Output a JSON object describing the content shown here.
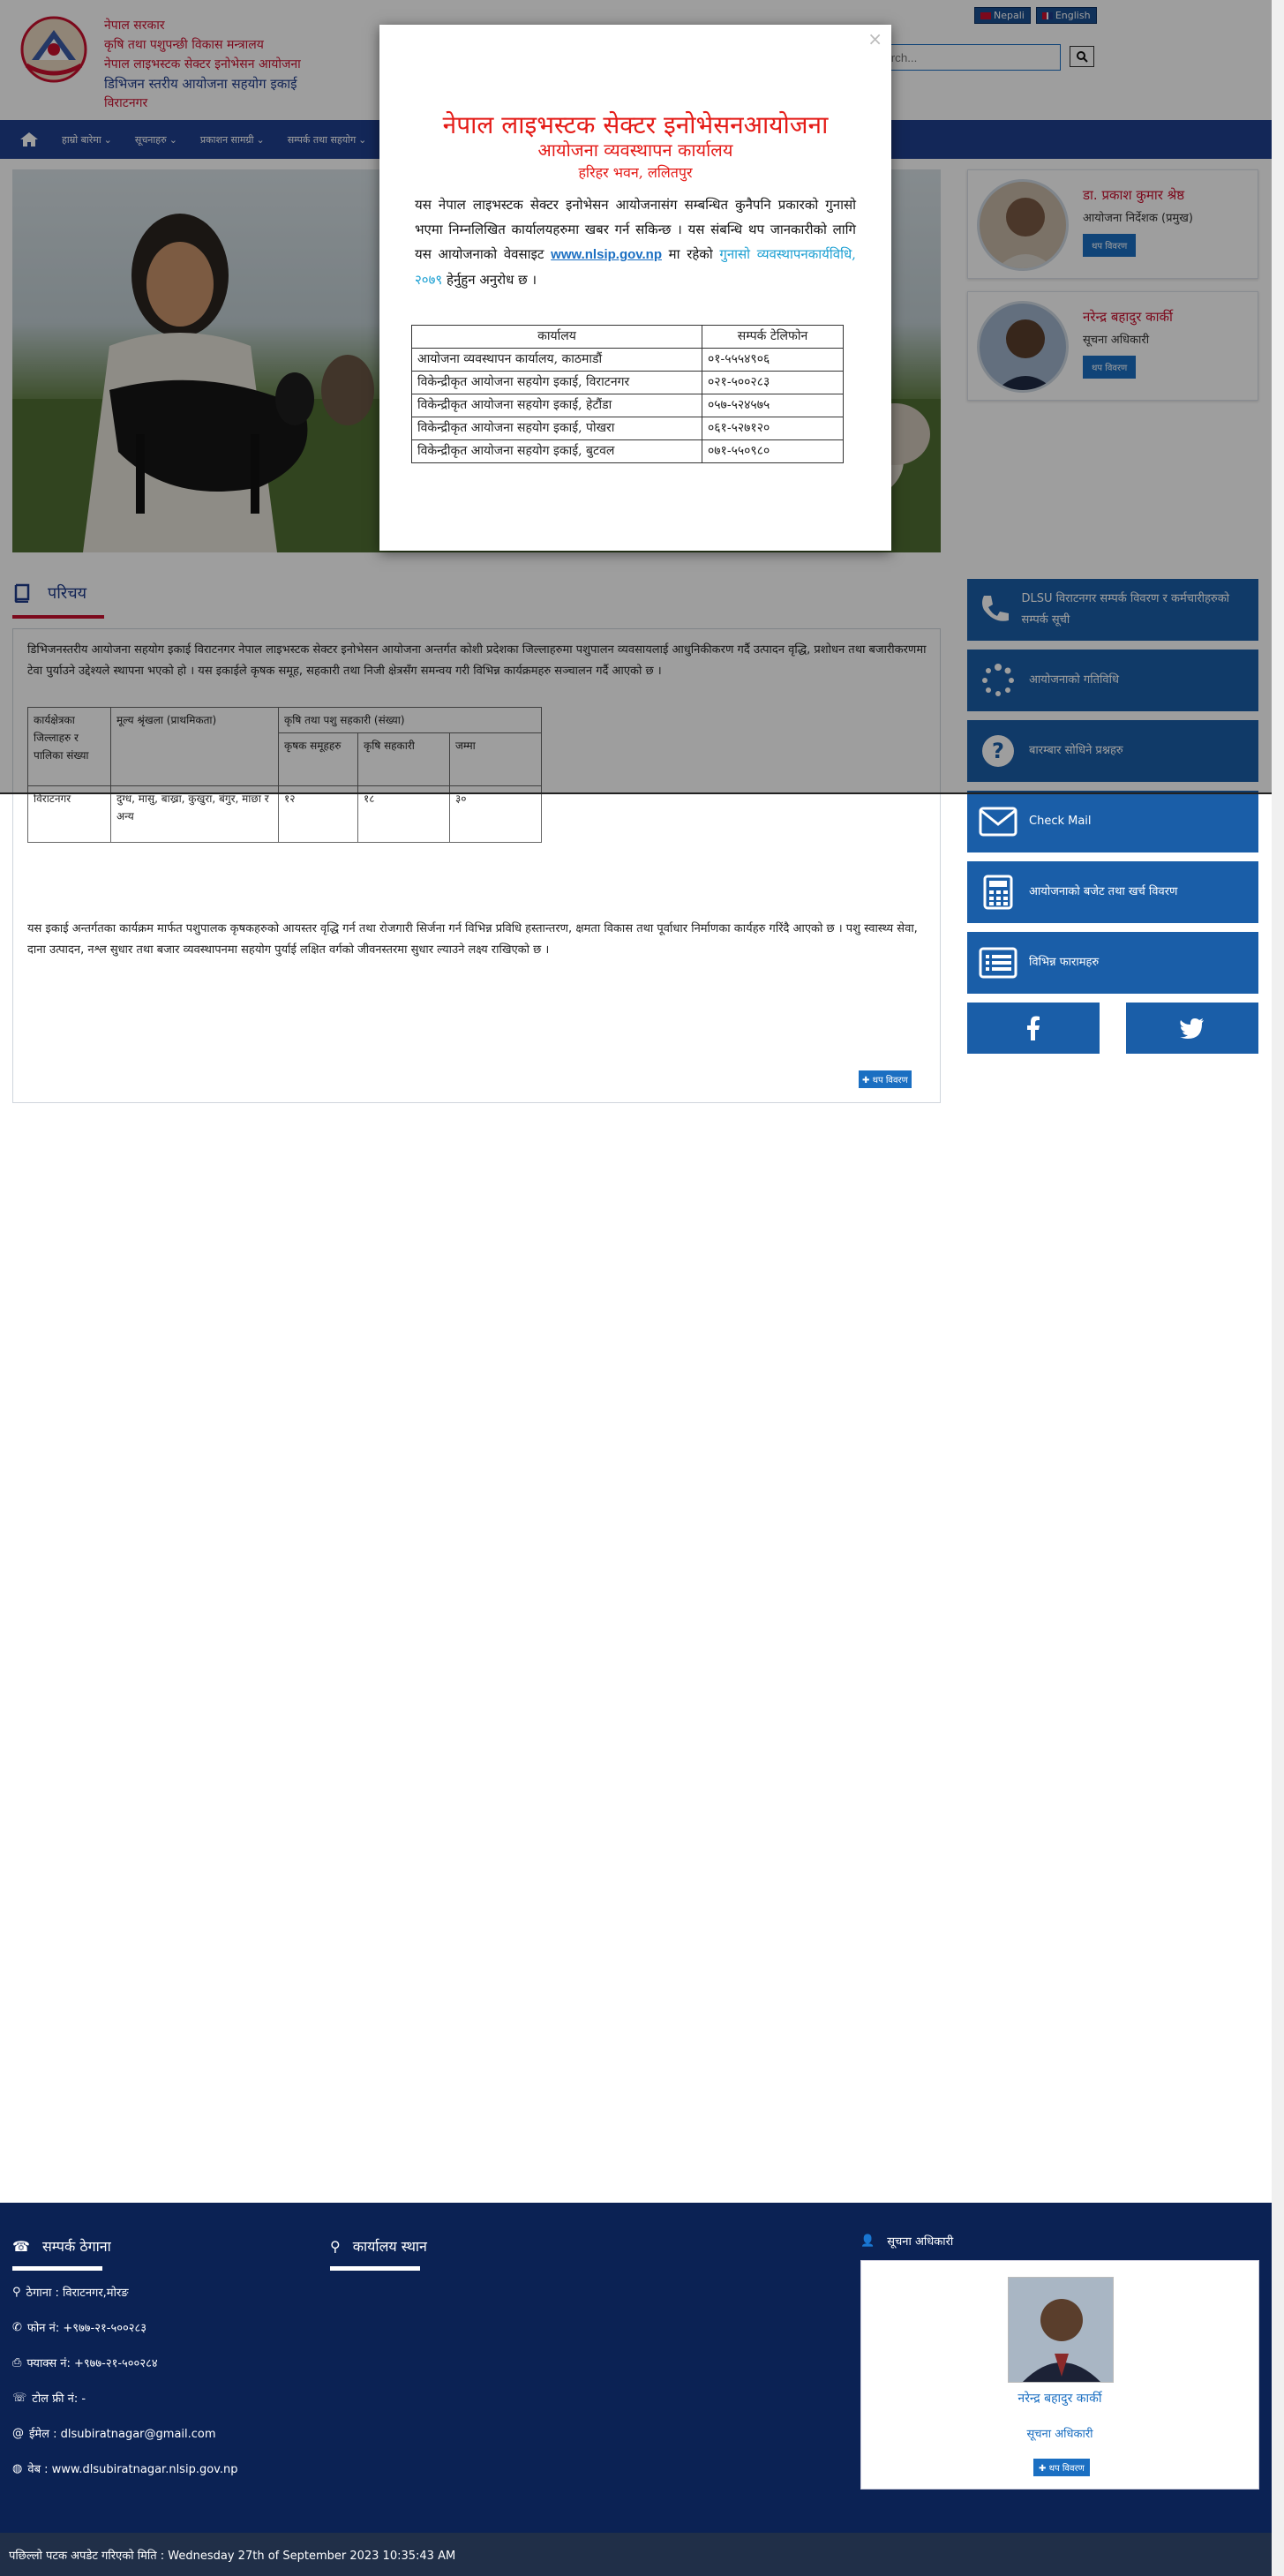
{
  "header": {
    "gov_line1": "नेपाल सरकार",
    "gov_line2": "कृषि तथा पशुपन्छी विकास मन्त्रालय",
    "gov_line3": "नेपाल लाइभस्टक सेक्टर इनोभेसन आयोजना",
    "gov_line4": "डिभिजन स्तरीय आयोजना सहयोग इकाई",
    "gov_line5": "विराटनगर",
    "lang_nepali": "Nepali",
    "lang_english": "English",
    "search_placeholder": "Search..."
  },
  "nav": {
    "items": [
      "हाम्रो बारेमा",
      "सूचनाहरु",
      "प्रकाशन सामग्री",
      "सम्पर्क तथा सहयोग"
    ]
  },
  "officials": [
    {
      "name": "डा. प्रकाश कुमार श्रेष्ठ",
      "role": "आयोजना निर्देशक (प्रमुख)",
      "more": "थप विवरण"
    },
    {
      "name": "नरेन्द्र बहादुर कार्की",
      "role": "सूचना अधिकारी",
      "more": "थप विवरण"
    }
  ],
  "side_buttons": [
    {
      "icon": "phone-icon",
      "label": "DLSU विराटनगर सम्पर्क विवरण र कर्मचारीहरुको सम्पर्क सूची"
    },
    {
      "icon": "spinner-icon",
      "label": "आयोजनाको गतिविधि"
    },
    {
      "icon": "question-icon",
      "label": "बारम्बार सोधिने प्रश्नहरु"
    },
    {
      "icon": "mail-icon",
      "label": "Check Mail"
    },
    {
      "icon": "calculator-icon",
      "label": "आयोजनाको बजेट तथा खर्च विवरण"
    },
    {
      "icon": "list-icon",
      "label": "विभिन्न फारामहरु"
    }
  ],
  "intro": {
    "title": "परिचय",
    "para1": "डिभिजनस्तरीय आयोजना सहयोग इकाई विराटनगर नेपाल लाइभस्टक सेक्टर इनोभेसन आयोजना अन्तर्गत कोशी प्रदेशका जिल्लाहरुमा पशुपालन व्यवसायलाई आधुनिकीकरण गर्दै उत्पादन वृद्धि, प्रशोधन तथा बजारीकरणमा टेवा पुर्याउने उद्देश्यले स्थापना भएको हो । यस इकाईले कृषक समूह, सहकारी तथा निजी क्षेत्रसँग समन्वय गरी विभिन्न कार्यक्रमहरु सञ्चालन गर्दै आएको छ ।",
    "table": {
      "h_district": "कार्यक्षेत्रका जिल्लाहरु र पालिका संख्या",
      "h_sector": "मूल्य श्रृंखला (प्राथमिकता)",
      "h_group": "कृषि तथा पशु सहकारी (संख्या)",
      "h_col1": "कृषक समूहहरु",
      "h_col2": "कृषि सहकारी",
      "h_col3": "जम्मा",
      "row_district": "विराटनगर",
      "row_sector": "दुग्ध, मासु, बाख्रा, कुखुरा, बंगुर, माछा र अन्य",
      "row_v1": "१२",
      "row_v2": "१८",
      "row_v3": "३०"
    },
    "para2": "यस इकाई अन्तर्गतका कार्यक्रम मार्फत पशुपालक कृषकहरुको आयस्तर वृद्धि गर्न तथा रोजगारी सिर्जना गर्न विभिन्न प्रविधि हस्तान्तरण, क्षमता विकास तथा पूर्वाधार निर्माणका कार्यहरु गरिंदै आएको छ । पशु स्वास्थ्य सेवा, दाना उत्पादन, नश्ल सुधार तथा बजार व्यवस्थापनमा सहयोग पुर्याई लक्षित वर्गको जीवनस्तरमा सुधार ल्याउने लक्ष्य राखिएको छ ।",
    "read_more": "थप विवरण"
  },
  "modal": {
    "title": "नेपाल लाइभस्टक सेक्टर इनोभेसनआयोजना",
    "subtitle": "आयोजना व्यवस्थापन कार्यालय",
    "address": "हरिहर भवन, ललितपुर",
    "body_pre": "यस नेपाल लाइभस्टक सेक्टर इनोभेसन आयोजनासंग सम्बन्धित कुनैपनि प्रकारको गुनासो भएमा निम्नलिखित कार्यालयहरुमा खबर गर्न सकिन्छ । यस संबन्धि थप जानकारीको लागि यस आयोजनाको वेवसाइट",
    "link": "www.nlsip.gov.np",
    "body_mid": "मा रहेको",
    "citation": "गुनासो व्यवस्थापनकार्यविधि, २०७९",
    "body_post": "हेर्नुहुन अनुरोध छ ।",
    "table_head": [
      "कार्यालय",
      "सम्पर्क टेलिफोन"
    ],
    "rows": [
      [
        "आयोजना व्यवस्थापन कार्यालय, काठमाडौं",
        "०१-५५५४९०६"
      ],
      [
        "विकेन्द्रीकृत आयोजना सहयोग इकाई, विराटनगर",
        "०२१-५००२८३"
      ],
      [
        "विकेन्द्रीकृत आयोजना सहयोग इकाई, हेटौंडा",
        "०५७-५२४५७५"
      ],
      [
        "विकेन्द्रीकृत आयोजना सहयोग इकाई, पोखरा",
        "०६१-५२७१२०"
      ],
      [
        "विकेन्द्रीकृत आयोजना सहयोग इकाई, बुटवल",
        "०७१-५५०९८०"
      ]
    ]
  },
  "footer": {
    "contact_title": "सम्पर्क ठेगाना",
    "location_title": "कार्यालय स्थान",
    "info_officer_title": "सूचना अधिकारी",
    "address": "ठेगाना : विराटनगर,मोरङ",
    "phone": "फोन नं: +९७७-२१-५००२८३",
    "fax": "फ्याक्स नं: +९७७-२१-५००२८४",
    "tollfree": "टोल फ्री नं: -",
    "email": "ईमेल : dlsubiratnagar@gmail.com",
    "web": "वेब : www.dlsubiratnagar.nlsip.gov.np",
    "officer_name": "नरेन्द्र बहादुर कार्की",
    "officer_role": "सूचना अधिकारी",
    "officer_more": "थप विवरण"
  },
  "bottom": {
    "updated": "पछिल्लो पटक अपडेट गरिएको मिति : Wednesday 27th of September 2023 10:35:43 AM"
  },
  "colors": {
    "brand_blue": "#1f3f8f",
    "accent_red": "#c8102e",
    "footer_navy": "#0b2254",
    "button_blue": "#1a5ea8"
  }
}
